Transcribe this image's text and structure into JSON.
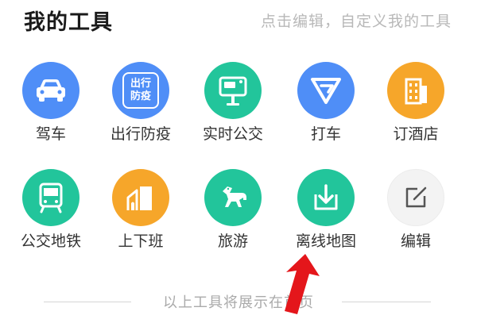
{
  "header": {
    "title": "我的工具",
    "hint": "点击编辑，自定义我的工具"
  },
  "colors": {
    "blue": "#4f8ef7",
    "green": "#22c59b",
    "orange": "#f6a62a",
    "edit_bg": "#f3f3f3",
    "arrow": "#e4161b"
  },
  "tools": [
    {
      "label": "驾车",
      "icon": "car-icon",
      "color": "blue"
    },
    {
      "label": "出行防疫",
      "icon": "epidemic-icon",
      "color": "blue",
      "icon_text_1": "出行",
      "icon_text_2": "防疫"
    },
    {
      "label": "实时公交",
      "icon": "bus-stop-icon",
      "color": "green"
    },
    {
      "label": "打车",
      "icon": "taxi-icon",
      "color": "blue"
    },
    {
      "label": "订酒店",
      "icon": "hotel-icon",
      "color": "orange"
    },
    {
      "label": "公交地铁",
      "icon": "subway-icon",
      "color": "green"
    },
    {
      "label": "上下班",
      "icon": "commute-icon",
      "color": "orange"
    },
    {
      "label": "旅游",
      "icon": "horse-icon",
      "color": "green"
    },
    {
      "label": "离线地图",
      "icon": "download-icon",
      "color": "green"
    },
    {
      "label": "编辑",
      "icon": "edit-icon",
      "color": "edit_bg"
    }
  ],
  "footer": {
    "text": "以上工具将展示在首页"
  }
}
